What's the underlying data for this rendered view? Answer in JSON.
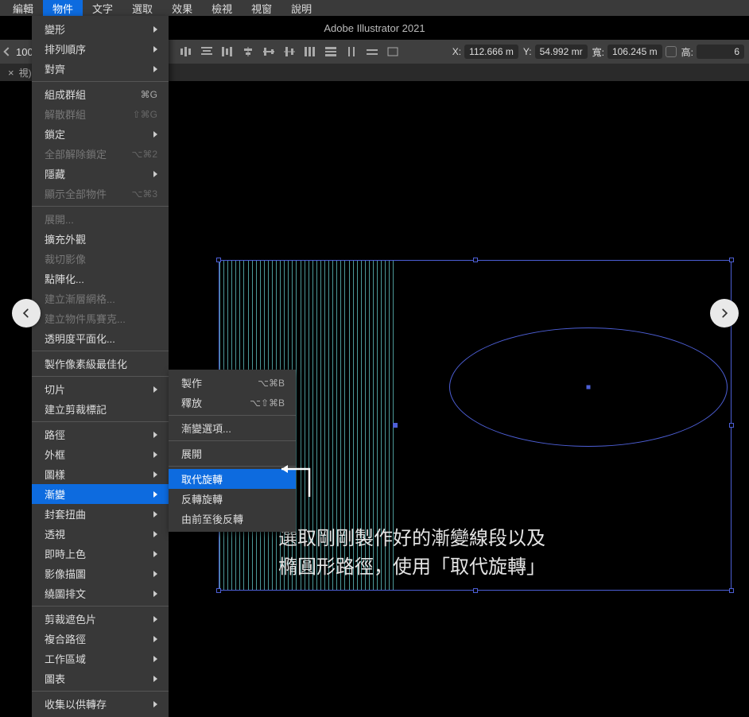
{
  "app_title": "Adobe Illustrator 2021",
  "menubar": [
    "編輯",
    "物件",
    "文字",
    "選取",
    "效果",
    "檢視",
    "視窗",
    "說明"
  ],
  "menubar_active_index": 1,
  "controlbar": {
    "zoom": "100",
    "x_label": "X:",
    "x_value": "112.666 m",
    "y_label": "Y:",
    "y_value": "54.992 mr",
    "w_label": "寬:",
    "w_value": "106.245 m",
    "h_label": "高:",
    "h_value": "6"
  },
  "tab": {
    "label": "視)"
  },
  "menu_main": [
    {
      "label": "變形",
      "sub": true
    },
    {
      "label": "排列順序",
      "sub": true
    },
    {
      "label": "對齊",
      "sub": true
    },
    {
      "sep": true
    },
    {
      "label": "組成群組",
      "shortcut": "⌘G"
    },
    {
      "label": "解散群組",
      "shortcut": "⇧⌘G",
      "disabled": true
    },
    {
      "label": "鎖定",
      "sub": true
    },
    {
      "label": "全部解除鎖定",
      "shortcut": "⌥⌘2",
      "disabled": true
    },
    {
      "label": "隱藏",
      "sub": true
    },
    {
      "label": "顯示全部物件",
      "shortcut": "⌥⌘3",
      "disabled": true
    },
    {
      "sep": true
    },
    {
      "label": "展開...",
      "disabled": true
    },
    {
      "label": "擴充外觀"
    },
    {
      "label": "裁切影像",
      "disabled": true
    },
    {
      "label": "點陣化..."
    },
    {
      "label": "建立漸層網格...",
      "disabled": true
    },
    {
      "label": "建立物件馬賽克...",
      "disabled": true
    },
    {
      "label": "透明度平面化..."
    },
    {
      "sep": true
    },
    {
      "label": "製作像素級最佳化"
    },
    {
      "sep": true
    },
    {
      "label": "切片",
      "sub": true
    },
    {
      "label": "建立剪裁標記"
    },
    {
      "sep": true
    },
    {
      "label": "路徑",
      "sub": true
    },
    {
      "label": "外框",
      "sub": true
    },
    {
      "label": "圖樣",
      "sub": true
    },
    {
      "label": "漸變",
      "sub": true,
      "highlighted": true
    },
    {
      "label": "封套扭曲",
      "sub": true
    },
    {
      "label": "透視",
      "sub": true
    },
    {
      "label": "即時上色",
      "sub": true
    },
    {
      "label": "影像描圖",
      "sub": true
    },
    {
      "label": "繞圖排文",
      "sub": true
    },
    {
      "sep": true
    },
    {
      "label": "剪裁遮色片",
      "sub": true
    },
    {
      "label": "複合路徑",
      "sub": true
    },
    {
      "label": "工作區域",
      "sub": true
    },
    {
      "label": "圖表",
      "sub": true
    },
    {
      "sep": true
    },
    {
      "label": "收集以供轉存",
      "sub": true
    }
  ],
  "menu_sub": [
    {
      "label": "製作",
      "shortcut": "⌥⌘B"
    },
    {
      "label": "釋放",
      "shortcut": "⌥⇧⌘B"
    },
    {
      "sep": true
    },
    {
      "label": "漸變選項..."
    },
    {
      "sep": true
    },
    {
      "label": "展開"
    },
    {
      "sep": true
    },
    {
      "label": "取代旋轉",
      "highlighted": true
    },
    {
      "label": "反轉旋轉"
    },
    {
      "label": "由前至後反轉"
    }
  ],
  "caption_line1": "選取剛剛製作好的漸變線段以及",
  "caption_line2": "橢圓形路徑，使用「取代旋轉」"
}
